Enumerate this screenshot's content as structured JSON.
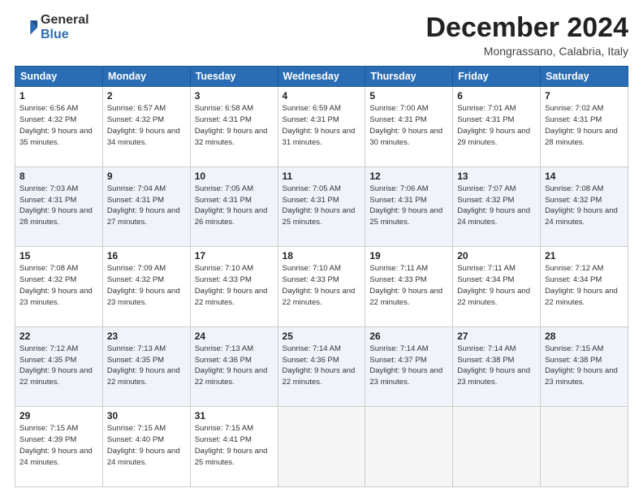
{
  "logo": {
    "general": "General",
    "blue": "Blue"
  },
  "title": "December 2024",
  "location": "Mongrassano, Calabria, Italy",
  "days_of_week": [
    "Sunday",
    "Monday",
    "Tuesday",
    "Wednesday",
    "Thursday",
    "Friday",
    "Saturday"
  ],
  "weeks": [
    [
      {
        "day": 1,
        "sunrise": "6:56 AM",
        "sunset": "4:32 PM",
        "daylight": "9 hours and 35 minutes."
      },
      {
        "day": 2,
        "sunrise": "6:57 AM",
        "sunset": "4:32 PM",
        "daylight": "9 hours and 34 minutes."
      },
      {
        "day": 3,
        "sunrise": "6:58 AM",
        "sunset": "4:31 PM",
        "daylight": "9 hours and 32 minutes."
      },
      {
        "day": 4,
        "sunrise": "6:59 AM",
        "sunset": "4:31 PM",
        "daylight": "9 hours and 31 minutes."
      },
      {
        "day": 5,
        "sunrise": "7:00 AM",
        "sunset": "4:31 PM",
        "daylight": "9 hours and 30 minutes."
      },
      {
        "day": 6,
        "sunrise": "7:01 AM",
        "sunset": "4:31 PM",
        "daylight": "9 hours and 29 minutes."
      },
      {
        "day": 7,
        "sunrise": "7:02 AM",
        "sunset": "4:31 PM",
        "daylight": "9 hours and 28 minutes."
      }
    ],
    [
      {
        "day": 8,
        "sunrise": "7:03 AM",
        "sunset": "4:31 PM",
        "daylight": "9 hours and 28 minutes."
      },
      {
        "day": 9,
        "sunrise": "7:04 AM",
        "sunset": "4:31 PM",
        "daylight": "9 hours and 27 minutes."
      },
      {
        "day": 10,
        "sunrise": "7:05 AM",
        "sunset": "4:31 PM",
        "daylight": "9 hours and 26 minutes."
      },
      {
        "day": 11,
        "sunrise": "7:05 AM",
        "sunset": "4:31 PM",
        "daylight": "9 hours and 25 minutes."
      },
      {
        "day": 12,
        "sunrise": "7:06 AM",
        "sunset": "4:31 PM",
        "daylight": "9 hours and 25 minutes."
      },
      {
        "day": 13,
        "sunrise": "7:07 AM",
        "sunset": "4:32 PM",
        "daylight": "9 hours and 24 minutes."
      },
      {
        "day": 14,
        "sunrise": "7:08 AM",
        "sunset": "4:32 PM",
        "daylight": "9 hours and 24 minutes."
      }
    ],
    [
      {
        "day": 15,
        "sunrise": "7:08 AM",
        "sunset": "4:32 PM",
        "daylight": "9 hours and 23 minutes."
      },
      {
        "day": 16,
        "sunrise": "7:09 AM",
        "sunset": "4:32 PM",
        "daylight": "9 hours and 23 minutes."
      },
      {
        "day": 17,
        "sunrise": "7:10 AM",
        "sunset": "4:33 PM",
        "daylight": "9 hours and 22 minutes."
      },
      {
        "day": 18,
        "sunrise": "7:10 AM",
        "sunset": "4:33 PM",
        "daylight": "9 hours and 22 minutes."
      },
      {
        "day": 19,
        "sunrise": "7:11 AM",
        "sunset": "4:33 PM",
        "daylight": "9 hours and 22 minutes."
      },
      {
        "day": 20,
        "sunrise": "7:11 AM",
        "sunset": "4:34 PM",
        "daylight": "9 hours and 22 minutes."
      },
      {
        "day": 21,
        "sunrise": "7:12 AM",
        "sunset": "4:34 PM",
        "daylight": "9 hours and 22 minutes."
      }
    ],
    [
      {
        "day": 22,
        "sunrise": "7:12 AM",
        "sunset": "4:35 PM",
        "daylight": "9 hours and 22 minutes."
      },
      {
        "day": 23,
        "sunrise": "7:13 AM",
        "sunset": "4:35 PM",
        "daylight": "9 hours and 22 minutes."
      },
      {
        "day": 24,
        "sunrise": "7:13 AM",
        "sunset": "4:36 PM",
        "daylight": "9 hours and 22 minutes."
      },
      {
        "day": 25,
        "sunrise": "7:14 AM",
        "sunset": "4:36 PM",
        "daylight": "9 hours and 22 minutes."
      },
      {
        "day": 26,
        "sunrise": "7:14 AM",
        "sunset": "4:37 PM",
        "daylight": "9 hours and 23 minutes."
      },
      {
        "day": 27,
        "sunrise": "7:14 AM",
        "sunset": "4:38 PM",
        "daylight": "9 hours and 23 minutes."
      },
      {
        "day": 28,
        "sunrise": "7:15 AM",
        "sunset": "4:38 PM",
        "daylight": "9 hours and 23 minutes."
      }
    ],
    [
      {
        "day": 29,
        "sunrise": "7:15 AM",
        "sunset": "4:39 PM",
        "daylight": "9 hours and 24 minutes."
      },
      {
        "day": 30,
        "sunrise": "7:15 AM",
        "sunset": "4:40 PM",
        "daylight": "9 hours and 24 minutes."
      },
      {
        "day": 31,
        "sunrise": "7:15 AM",
        "sunset": "4:41 PM",
        "daylight": "9 hours and 25 minutes."
      },
      null,
      null,
      null,
      null
    ]
  ]
}
